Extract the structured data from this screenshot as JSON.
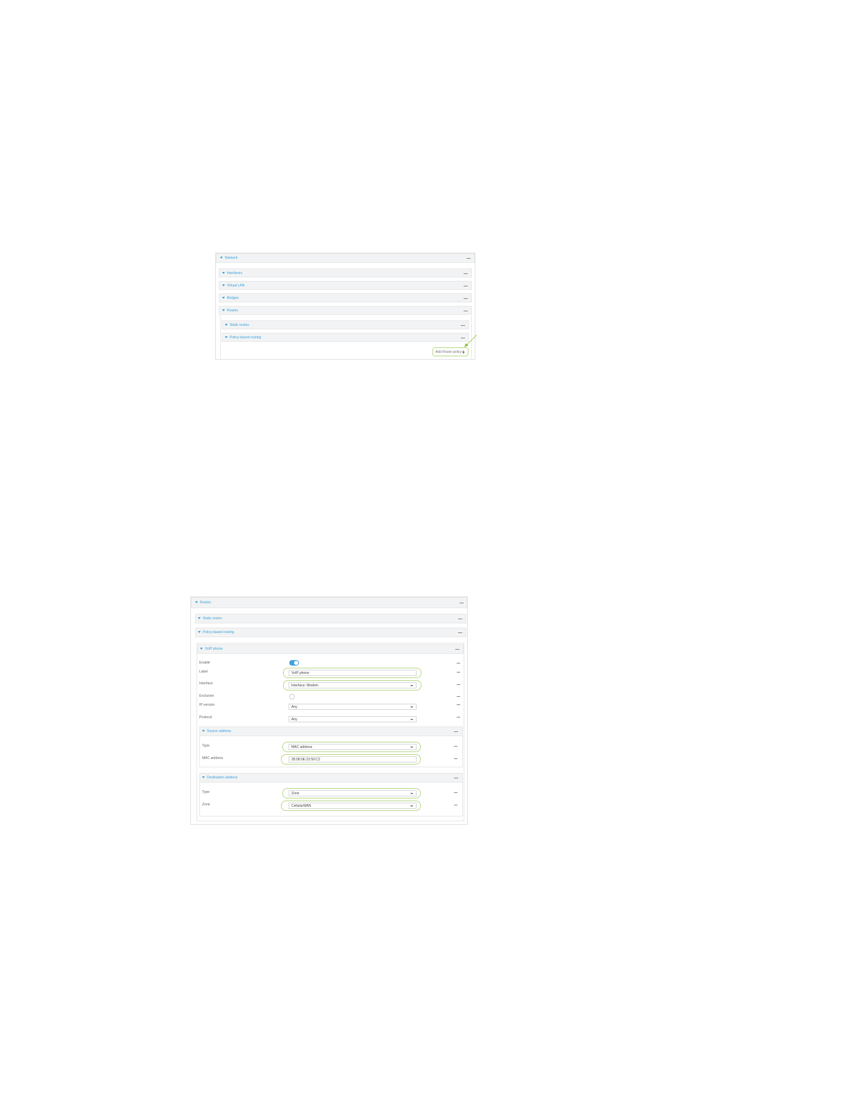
{
  "screenshot1": {
    "network_title": "Network",
    "interfaces_title": "Interfaces",
    "virtual_lan_title": "Virtual LAN",
    "bridges_title": "Bridges",
    "routes_title": "Routes",
    "static_routes_title": "Static routes",
    "policy_routing_title": "Policy-based routing",
    "add_button_label": "Add Route policy"
  },
  "screenshot2": {
    "routes_title": "Routes",
    "static_routes_title": "Static routes",
    "policy_routing_title": "Policy-based routing",
    "policy_title": "VoIP phone",
    "fields": {
      "enable_label": "Enable",
      "label_label": "Label",
      "label_value": "VoIP phone",
      "interface_label": "Interface",
      "interface_value": "Interface: Modem",
      "exclusive_label": "Exclusive",
      "ip_version_label": "IP version",
      "ip_version_value": "Any",
      "protocol_label": "Protocol",
      "protocol_value": "Any"
    },
    "source": {
      "title": "Source address",
      "type_label": "Type",
      "type_value": "MAC address",
      "mac_label": "MAC address",
      "mac_value": "28:08:0E:23:50:C2"
    },
    "destination": {
      "title": "Destination address",
      "type_label": "Type",
      "type_value": "Zone",
      "zone_label": "Zone",
      "zone_value": "CellularWAN"
    }
  },
  "colors": {
    "accent": "#3fa3dc",
    "highlight": "#b9d98a",
    "header_bg": "#f2f3f4"
  }
}
